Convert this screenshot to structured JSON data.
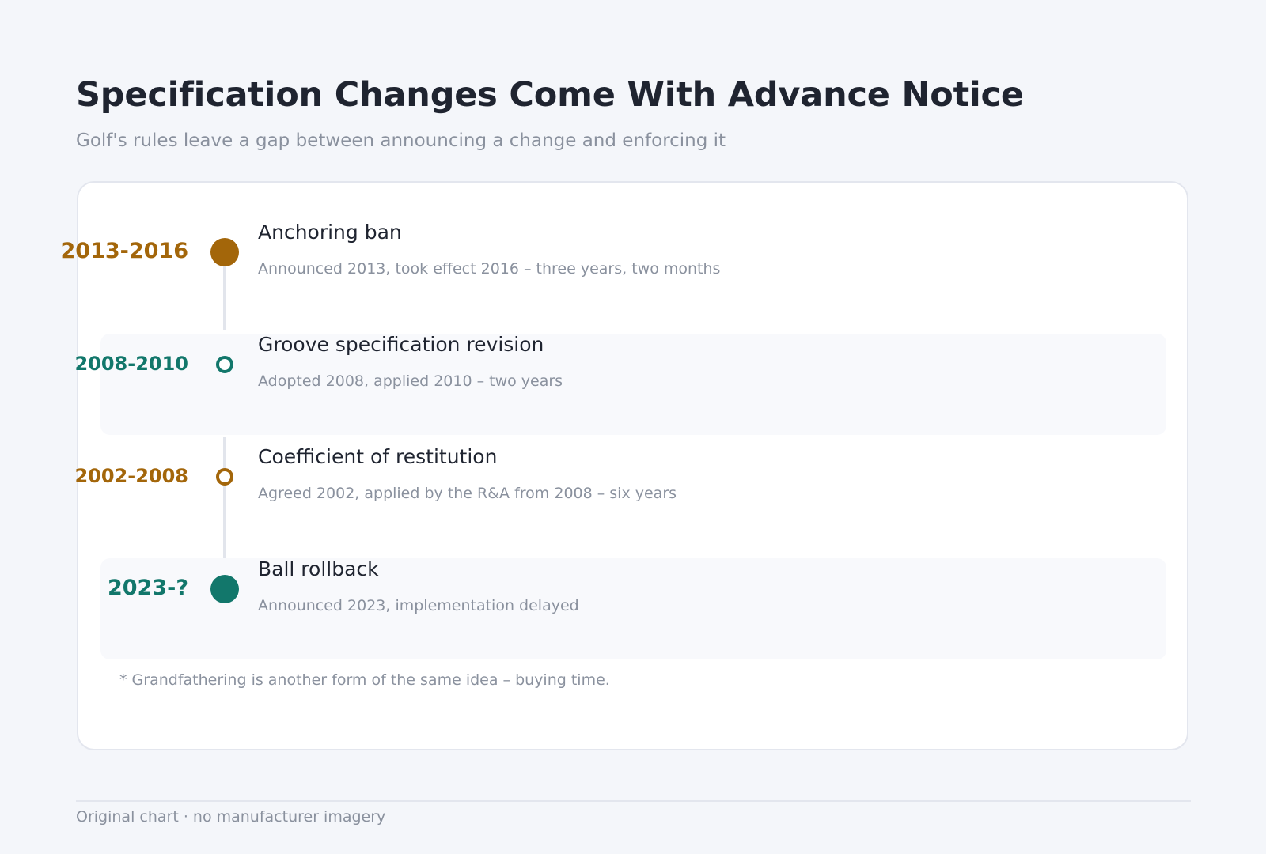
{
  "header": {
    "title": "Specification Changes Come With Advance Notice",
    "subtitle": "Golf's rules leave a gap between announcing a change and enforcing it"
  },
  "colors": {
    "amber": "#a3660a",
    "teal": "#12776b",
    "row_highlight": "#f8f9fc",
    "connector": "#e2e5ec"
  },
  "timeline": [
    {
      "period": "2013-2016",
      "title": "Anchoring ban",
      "description": "Announced 2013, took effect 2016 – three years, two months",
      "color": "#a3660a",
      "marker": "filled",
      "highlighted": false
    },
    {
      "period": "2008-2010",
      "title": "Groove specification revision",
      "description": "Adopted 2008, applied 2010 – two years",
      "color": "#12776b",
      "marker": "hollow",
      "highlighted": true
    },
    {
      "period": "2002-2008",
      "title": "Coefficient of restitution",
      "description": "Agreed 2002, applied by the R&A from 2008 – six years",
      "color": "#a3660a",
      "marker": "hollow",
      "highlighted": false
    },
    {
      "period": "2023-?",
      "title": "Ball rollback",
      "description": "Announced 2023, implementation delayed",
      "color": "#12776b",
      "marker": "filled",
      "highlighted": true
    }
  ],
  "footnote": "* Grandfathering is another form of the same idea – buying time.",
  "footer": "Original chart · no manufacturer imagery"
}
